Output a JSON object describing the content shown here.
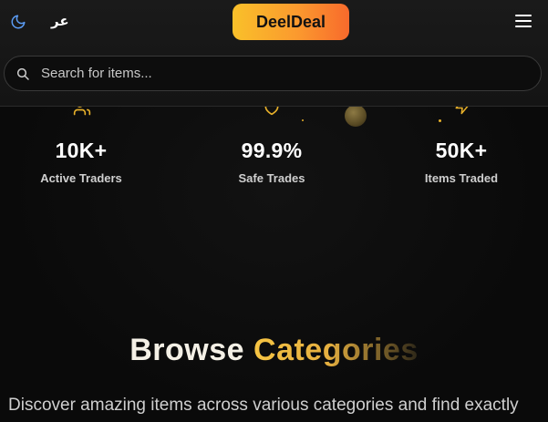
{
  "header": {
    "theme_icon": "moon-icon",
    "language_label": "عر",
    "logo_text": "DeelDeal",
    "menu_icon": "hamburger-menu-icon",
    "brand_gradient": [
      "#f9c02a",
      "#f86a2c"
    ]
  },
  "search": {
    "icon": "search-icon",
    "placeholder": "Search for items...",
    "value": ""
  },
  "stats": [
    {
      "icon": "users-icon",
      "value": "10K+",
      "label": "Active Traders"
    },
    {
      "icon": "shield-icon",
      "value": "99.9%",
      "label": "Safe Trades"
    },
    {
      "icon": "lightning-icon",
      "value": "50K+",
      "label": "Items Traded"
    }
  ],
  "section": {
    "title_part1": "Browse",
    "title_part2": "Categories",
    "description": "Discover amazing items across various categories and find exactly",
    "accent_color": "#f6c443"
  }
}
